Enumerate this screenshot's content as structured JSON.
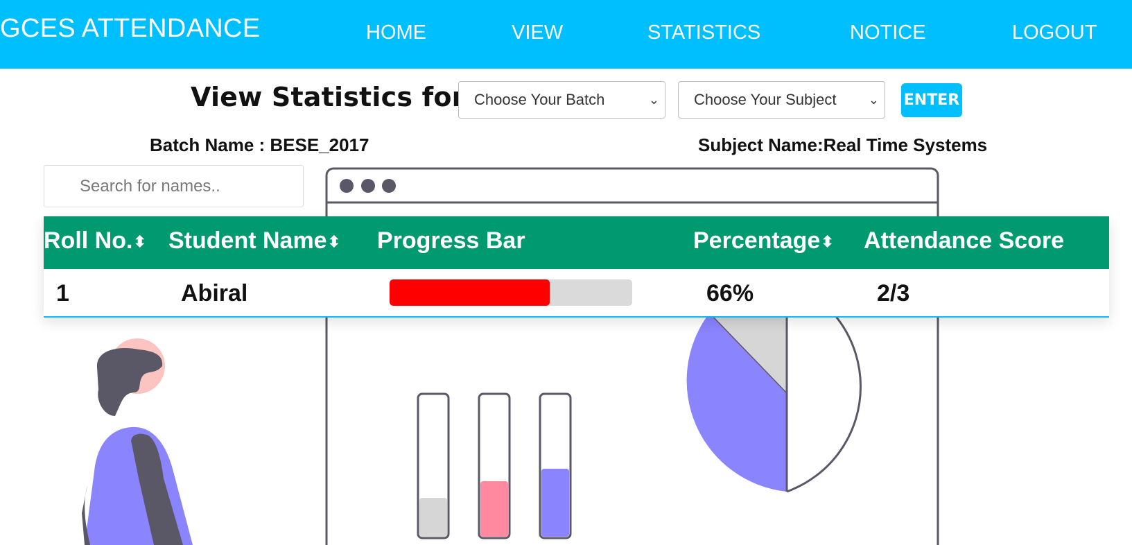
{
  "app": {
    "brand": "GCES ATTENDANCE"
  },
  "nav": {
    "home": "HOME",
    "view": "VIEW",
    "statistics": "STATISTICS",
    "notice": "NOTICE",
    "logout": "LOGOUT"
  },
  "filters": {
    "heading": "View Statistics for",
    "batch_select": "Choose Your Batch",
    "subject_select": "Choose Your Subject",
    "enter_label": "ENTER"
  },
  "info": {
    "batch": "Batch Name : BESE_2017",
    "subject": "Subject Name:Real Time Systems"
  },
  "search": {
    "placeholder": "Search for names.."
  },
  "table": {
    "headers": {
      "roll": "Roll No.",
      "name": "Student Name",
      "progress": "Progress Bar",
      "percentage": "Percentage",
      "score": "Attendance Score"
    },
    "rows": [
      {
        "roll": "1",
        "name": "Abiral",
        "progress": 0.66,
        "percentage": "66%",
        "score": "2/3"
      }
    ]
  },
  "colors": {
    "navbar": "#00bfff",
    "table_header": "#009970",
    "progress_fill": "#ff0000",
    "progress_track": "#dadada",
    "illustration_purple": "#8a84ff",
    "illustration_dark": "#5a5866",
    "illustration_pink": "#ff8aa0"
  },
  "icons": {
    "sort": "sort-icon",
    "chevron": "chevron-down-icon"
  }
}
